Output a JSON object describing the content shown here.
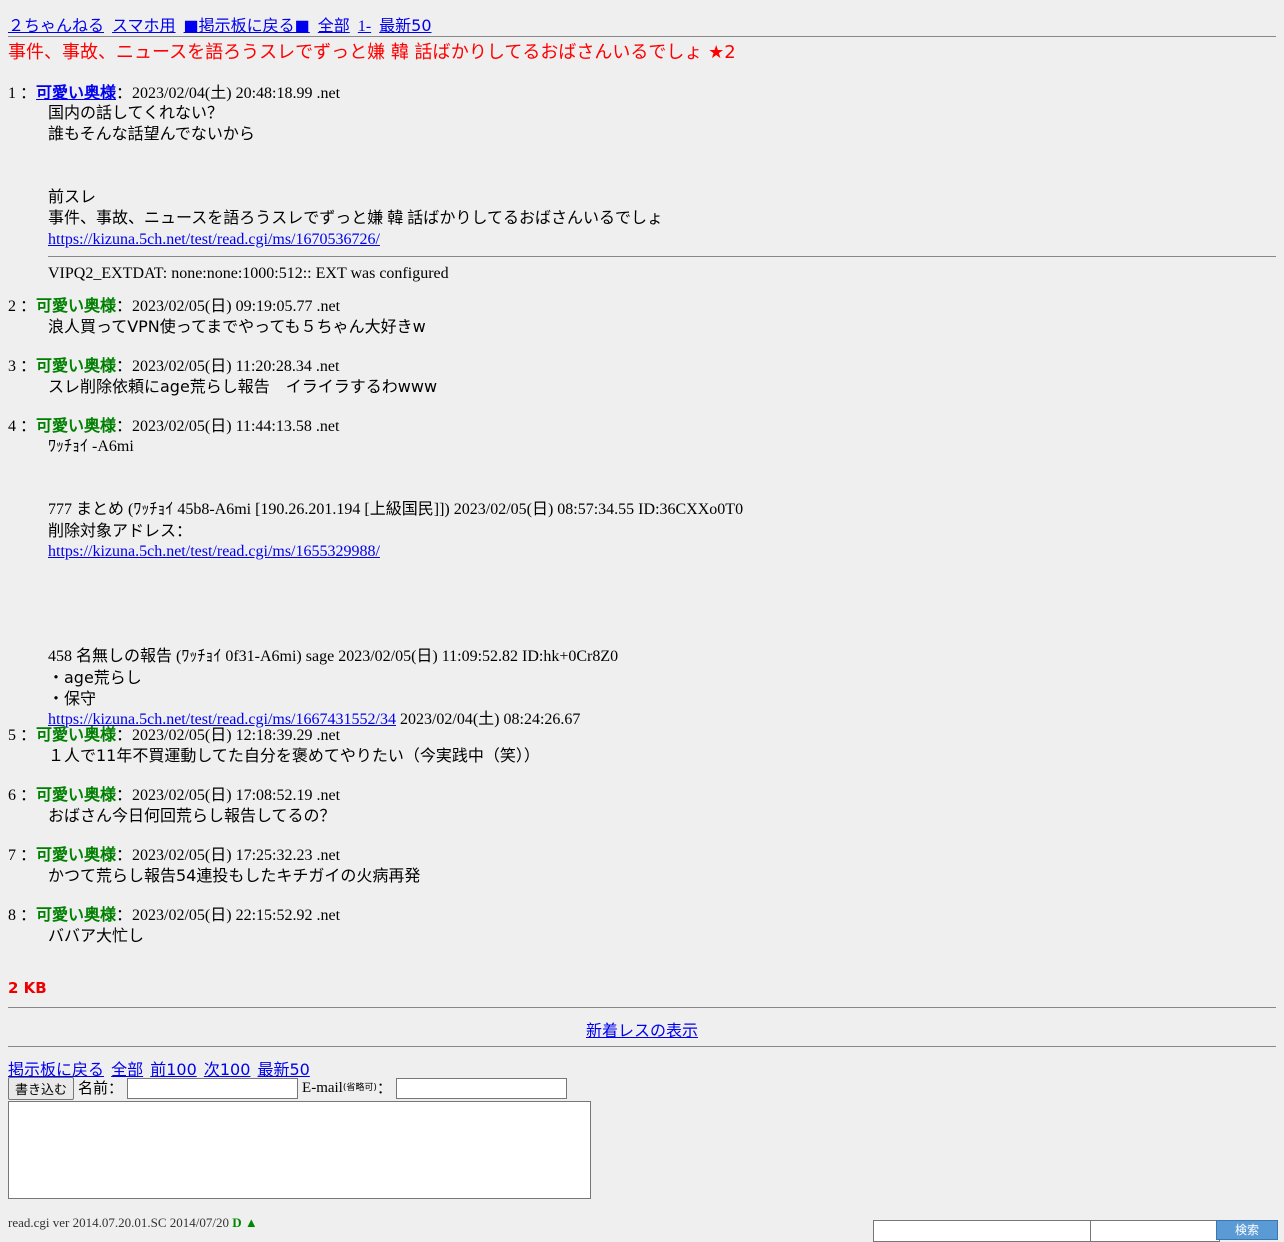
{
  "nav": {
    "top": [
      "２ちゃんねる",
      "スマホ用",
      "■掲示板に戻る■",
      "全部",
      "1-",
      "最新50"
    ]
  },
  "thread": {
    "title": "事件、事故、ニュースを語ろうスレでずっと嫌 韓 話ばかりしてるおばさんいるでしょ ★2"
  },
  "posts": [
    {
      "num": "1 ：",
      "name": "可愛い奥様",
      "date": "：2023/02/04(土) 20:48:18.99 .net",
      "body": [
        "国内の話してくれない？",
        "誰もそんな話望んでないから",
        "",
        "",
        "前スレ",
        "事件、事故、ニュースを語ろうスレでずっと嫌 韓 話ばかりしてるおばさんいるでしょ"
      ],
      "link": "https://kizuna.5ch.net/test/read.cgi/ms/1670536726/",
      "ext": "VIPQ2_EXTDAT: none:none:1000:512:: EXT was configured"
    },
    {
      "num": "2 ：",
      "name": "可愛い奥様",
      "date": "：2023/02/05(日) 09:19:05.77 .net",
      "body": [
        "浪人買ってVPN使ってまでやっても５ちゃん大好きw"
      ]
    },
    {
      "num": "3 ：",
      "name": "可愛い奥様",
      "date": "：2023/02/05(日) 11:20:28.34 .net",
      "body": [
        "スレ削除依頼にage荒らし報告　イライラするわwww"
      ]
    },
    {
      "num": "4 ：",
      "name": "可愛い奥様",
      "date": "：2023/02/05(日) 11:44:13.58 .net",
      "l1": "ﾜｯﾁｮｲ -A6mi",
      "l2": "777 まとめ (ﾜｯﾁｮｲ 45b8-A6mi [190.26.201.194 [上級国民]]) 2023/02/05(日) 08:57:34.55 ID:36CXXo0T0",
      "l3": "削除対象アドレス：",
      "link1": "https://kizuna.5ch.net/test/read.cgi/ms/1655329988/",
      "l4": "458 名無しの報告 (ﾜｯﾁｮｲ 0f31-A6mi) sage 2023/02/05(日) 11:09:52.82 ID:hk+0Cr8Z0",
      "l5": "・age荒らし",
      "l6": "・保守",
      "link2": "https://kizuna.5ch.net/test/read.cgi/ms/1667431552/34",
      "l7": " 2023/02/04(土) 08:24:26.67"
    },
    {
      "num": "5 ：",
      "name": "可愛い奥様",
      "date": "：2023/02/05(日) 12:18:39.29 .net",
      "body": [
        "１人で11年不買運動してた自分を褒めてやりたい（今実践中（笑））"
      ]
    },
    {
      "num": "6 ：",
      "name": "可愛い奥様",
      "date": "：2023/02/05(日) 17:08:52.19 .net",
      "body": [
        "おばさん今日何回荒らし報告してるの？"
      ]
    },
    {
      "num": "7 ：",
      "name": "可愛い奥様",
      "date": "：2023/02/05(日) 17:25:32.23 .net",
      "body": [
        "かつて荒らし報告54連投もしたキチガイの火病再発"
      ]
    },
    {
      "num": "8 ：",
      "name": "可愛い奥様",
      "date": "：2023/02/05(日) 22:15:52.92 .net",
      "body": [
        "ババア大忙し"
      ]
    }
  ],
  "size": "2 KB",
  "new_res": "新着レスの表示",
  "bottom_nav": [
    "掲示板に戻る",
    "全部",
    "前100",
    "次100",
    "最新50"
  ],
  "form": {
    "submit": "書き込む",
    "name_label": "名前：",
    "email_label": "E-mail",
    "email_note": "(省略可)",
    "email_colon": "："
  },
  "footer": {
    "text": "read.cgi ver 2014.07.20.01.SC 2014/07/20",
    "badge": "D ▲",
    "search_button": "検索"
  }
}
